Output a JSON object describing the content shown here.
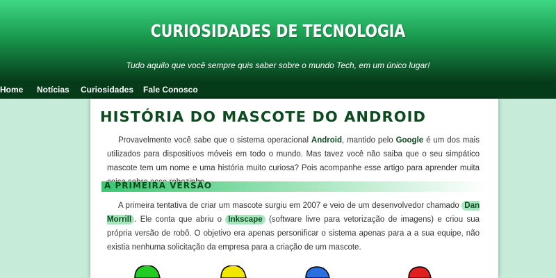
{
  "header": {
    "title": "CURIOSIDADES DE TECNOLOGIA",
    "subtitle": "Tudo aquilo que você sempre quis saber sobre o mundo Tech, em um único lugar!"
  },
  "nav": {
    "items": [
      {
        "label": "Home"
      },
      {
        "label": "Notícias"
      },
      {
        "label": "Curiosidades"
      },
      {
        "label": "Fale Conosco"
      }
    ]
  },
  "article": {
    "title": "História do Mascote do Android",
    "intro": {
      "t1": "Provavelmente você sabe que o sistema operacional ",
      "android": "Android",
      "t2": ", mantido pelo ",
      "google": "Google",
      "t3": " é um dos mais utilizados para dispositivos móveis em todo o mundo. Mas tavez você não saiba que o seu simpático mascote tem um nome e uma história muito curiosa? Pois acompanhe esse artigo para aprender muita coisa sobre esse robozinho."
    },
    "section1": {
      "heading": "A Primeira Versão",
      "t1": "A primeira tentativa de criar um mascote surgiu em 2007 e veio de um desenvolvedor chamado ",
      "dan": "Dan Morrill",
      "t2": ". Ele conta que abriu o ",
      "inkscape": "Inkscape",
      "t3": " (software livre para vetorização de imagens) e criou sua própria versão de robô. O objetivo era apenas personificar o sistema apenas para a a sua equipe, não existia nenhuma solicitação da empresa para a criação de um mascote."
    }
  },
  "colors": {
    "header_top": "#3fd785",
    "header_bottom": "#063b1a",
    "accent": "#0d4a1f",
    "pill": "#a8e6bf",
    "page_bg": "#c6ecd9"
  },
  "mascots": [
    {
      "color": "#22cc22"
    },
    {
      "color": "#f2e600"
    },
    {
      "color": "#2a6fe0"
    },
    {
      "color": "#e02020"
    }
  ]
}
